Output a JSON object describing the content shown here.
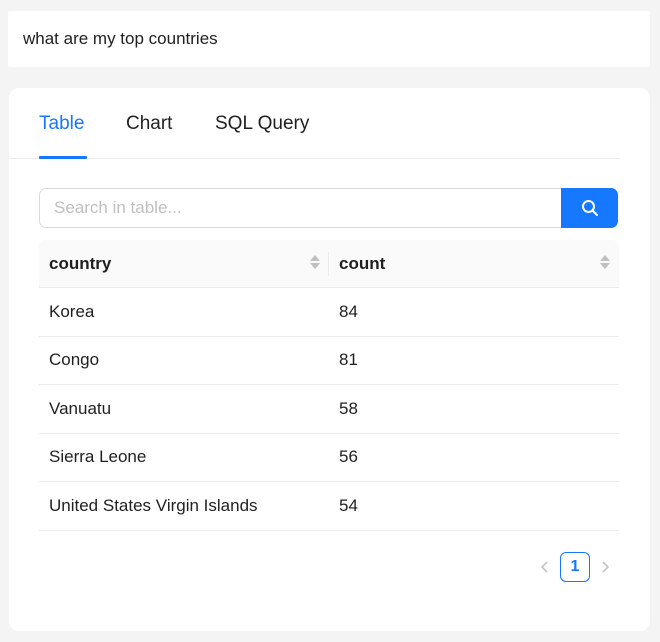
{
  "query": {
    "text": "what are my top countries"
  },
  "tabs": [
    {
      "label": "Table",
      "active": true
    },
    {
      "label": "Chart",
      "active": false
    },
    {
      "label": "SQL Query",
      "active": false
    }
  ],
  "search": {
    "placeholder": "Search in table...",
    "value": "",
    "button_icon": "search-icon"
  },
  "table": {
    "columns": [
      "country",
      "count"
    ],
    "rows": [
      {
        "country": "Korea",
        "count": "84"
      },
      {
        "country": "Congo",
        "count": "81"
      },
      {
        "country": "Vanuatu",
        "count": "58"
      },
      {
        "country": "Sierra Leone",
        "count": "56"
      },
      {
        "country": "United States Virgin Islands",
        "count": "54"
      }
    ]
  },
  "pagination": {
    "current_page": "1"
  },
  "colors": {
    "accent": "#1677ff",
    "background": "#f4f4f5",
    "card": "#ffffff"
  }
}
